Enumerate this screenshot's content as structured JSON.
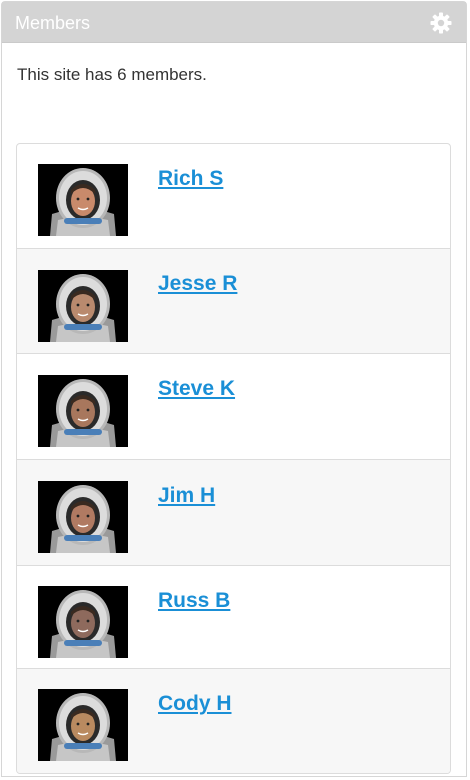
{
  "widget": {
    "title": "Members",
    "settings_icon": "gear-icon",
    "summary": "This site has 6 members."
  },
  "members": [
    {
      "name": "Rich S",
      "avatar": "astronaut-avatar",
      "face_color": "#c98a6b"
    },
    {
      "name": "Jesse R",
      "avatar": "astronaut-avatar",
      "face_color": "#b98a6e"
    },
    {
      "name": "Steve K",
      "avatar": "astronaut-avatar",
      "face_color": "#a8775d"
    },
    {
      "name": "Jim H",
      "avatar": "astronaut-avatar",
      "face_color": "#b07a62"
    },
    {
      "name": "Russ B",
      "avatar": "astronaut-avatar",
      "face_color": "#8e6a5d"
    },
    {
      "name": "Cody H",
      "avatar": "astronaut-avatar",
      "face_color": "#b98a60"
    }
  ],
  "colors": {
    "header_bg": "#d4d4d4",
    "link": "#1a8fd6",
    "alt_row": "#f7f7f7"
  }
}
